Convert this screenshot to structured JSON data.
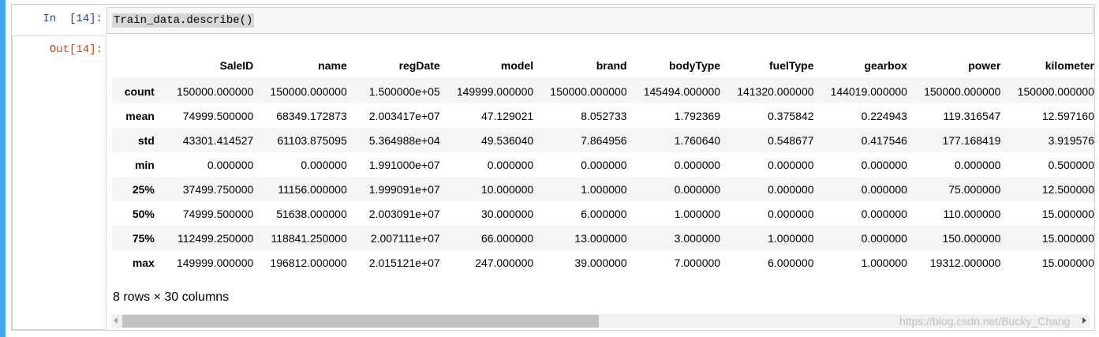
{
  "cell": {
    "in_prompt": "In  [14]:",
    "code": "Train_data.describe()",
    "out_prompt": "Out[14]:"
  },
  "table": {
    "columns": [
      "SaleID",
      "name",
      "regDate",
      "model",
      "brand",
      "bodyType",
      "fuelType",
      "gearbox",
      "power",
      "kilometer"
    ],
    "rows": [
      {
        "label": "count",
        "values": [
          "150000.000000",
          "150000.000000",
          "1.500000e+05",
          "149999.000000",
          "150000.000000",
          "145494.000000",
          "141320.000000",
          "144019.000000",
          "150000.000000",
          "150000.000000"
        ]
      },
      {
        "label": "mean",
        "values": [
          "74999.500000",
          "68349.172873",
          "2.003417e+07",
          "47.129021",
          "8.052733",
          "1.792369",
          "0.375842",
          "0.224943",
          "119.316547",
          "12.597160"
        ]
      },
      {
        "label": "std",
        "values": [
          "43301.414527",
          "61103.875095",
          "5.364988e+04",
          "49.536040",
          "7.864956",
          "1.760640",
          "0.548677",
          "0.417546",
          "177.168419",
          "3.919576"
        ]
      },
      {
        "label": "min",
        "values": [
          "0.000000",
          "0.000000",
          "1.991000e+07",
          "0.000000",
          "0.000000",
          "0.000000",
          "0.000000",
          "0.000000",
          "0.000000",
          "0.500000"
        ]
      },
      {
        "label": "25%",
        "values": [
          "37499.750000",
          "11156.000000",
          "1.999091e+07",
          "10.000000",
          "1.000000",
          "0.000000",
          "0.000000",
          "0.000000",
          "75.000000",
          "12.500000"
        ]
      },
      {
        "label": "50%",
        "values": [
          "74999.500000",
          "51638.000000",
          "2.003091e+07",
          "30.000000",
          "6.000000",
          "1.000000",
          "0.000000",
          "0.000000",
          "110.000000",
          "15.000000"
        ]
      },
      {
        "label": "75%",
        "values": [
          "112499.250000",
          "118841.250000",
          "2.007111e+07",
          "66.000000",
          "13.000000",
          "3.000000",
          "1.000000",
          "0.000000",
          "150.000000",
          "15.000000"
        ]
      },
      {
        "label": "max",
        "values": [
          "149999.000000",
          "196812.000000",
          "2.015121e+07",
          "247.000000",
          "39.000000",
          "7.000000",
          "6.000000",
          "1.000000",
          "19312.000000",
          "15.000000"
        ]
      }
    ]
  },
  "summary": "8 rows × 30 columns",
  "scrollbar": {
    "thumb_fraction": 0.49
  },
  "watermark": "https://blog.csdn.net/Bucky_Chang",
  "colors": {
    "accent_bar": "#42a5f5",
    "in_prompt": "#303f9f",
    "out_prompt": "#d84315"
  }
}
